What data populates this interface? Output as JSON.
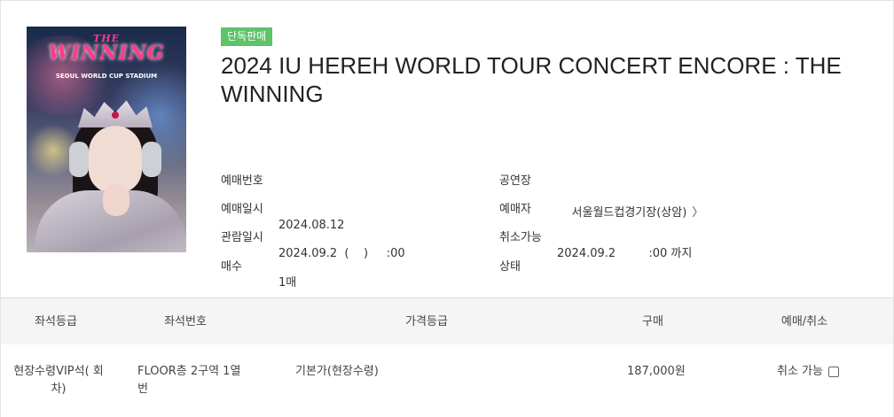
{
  "poster": {
    "logo_top": "THE",
    "logo_main": "WINNING",
    "subtitle": "SEOUL WORLD CUP STADIUM"
  },
  "badge": "단독판매",
  "title": "2024 IU HEREH WORLD TOUR CONCERT ENCORE : THE WINNING",
  "info": {
    "reservation_number_label": "예매번호",
    "reservation_number_value": "",
    "reservation_date_label": "예매일시",
    "reservation_date_value": "2024.08.12",
    "show_date_label": "관람일시",
    "show_date_value": "2024.09.2  (    )     :00",
    "count_label": "매수",
    "count_value": "1매",
    "venue_label": "공연장",
    "venue_value": "서울월드컵경기장(상암)",
    "venue_chevron": "〉",
    "booker_label": "예매자",
    "booker_value": "",
    "cancel_until_label": "취소가능",
    "cancel_until_value": "2024.09.2         :00 까지",
    "status_label": "상태",
    "status_value": ""
  },
  "table": {
    "headers": [
      "좌석등급",
      "좌석번호",
      "가격등급",
      "구매",
      "예매/취소"
    ],
    "row": {
      "seat_grade_line1": "현장수령VIP석(   회",
      "seat_grade_line2": "차)",
      "seat_number_line1": "FLOOR층 2구역 1열",
      "seat_number_line2": "번",
      "price_grade": "기본가(현장수령)",
      "price": "187,000원",
      "cancel_label": "취소 가능"
    }
  },
  "colors": {
    "badge_green": "#5ec36a",
    "header_bg": "#f5f5f5"
  }
}
